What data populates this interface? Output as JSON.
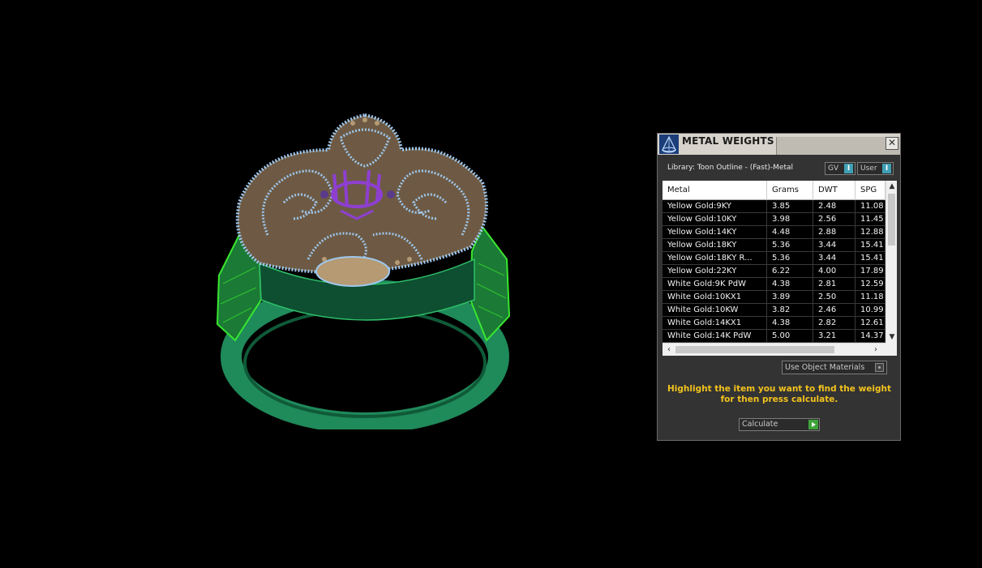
{
  "panel": {
    "title": "METAL WEIGHTS",
    "close_label": "✕",
    "library": "Library: Toon Outline - (Fast)-Metal",
    "toggles": [
      {
        "label": "GV",
        "indicator": "I"
      },
      {
        "label": "User",
        "indicator": "I"
      }
    ],
    "table": {
      "headers": [
        "Metal",
        "Grams",
        "DWT",
        "SPG"
      ],
      "rows": [
        [
          "Yellow Gold:9KY",
          "3.85",
          "2.48",
          "11.08"
        ],
        [
          "Yellow Gold:10KY",
          "3.98",
          "2.56",
          "11.45"
        ],
        [
          "Yellow Gold:14KY",
          "4.48",
          "2.88",
          "12.88"
        ],
        [
          "Yellow Gold:18KY",
          "5.36",
          "3.44",
          "15.41"
        ],
        [
          "Yellow Gold:18KY R...",
          "5.36",
          "3.44",
          "15.41"
        ],
        [
          "Yellow Gold:22KY",
          "6.22",
          "4.00",
          "17.89"
        ],
        [
          "White Gold:9K PdW",
          "4.38",
          "2.81",
          "12.59"
        ],
        [
          "White Gold:10KX1",
          "3.89",
          "2.50",
          "11.18"
        ],
        [
          "White Gold:10KW",
          "3.82",
          "2.46",
          "10.99"
        ],
        [
          "White Gold:14KX1",
          "4.38",
          "2.82",
          "12.61"
        ],
        [
          "White Gold:14K PdW",
          "5.00",
          "3.21",
          "14.37"
        ]
      ]
    },
    "use_object_materials": "Use Object Materials",
    "instructions": "Highlight the item you want to find the weight for then press calculate.",
    "calculate_label": "Calculate"
  },
  "colors": {
    "panel_bg": "#333333",
    "titlebar": "#d7d3cc",
    "instruction_text": "#f2c21d",
    "toggle_indicator": "#3fa0b4",
    "calc_go": "#3fa33a",
    "ring_band": "#1f8a5a",
    "ring_highlight": "#39e62f",
    "filigree": "#9ec8ee",
    "gold_metal": "#b59a74",
    "center_setting": "#8e3fd1"
  },
  "icons": {
    "app": "wireframe-cone-icon",
    "close": "close-icon",
    "scroll_up": "arrow-up-icon",
    "scroll_down": "arrow-down-icon",
    "scroll_left": "arrow-left-icon",
    "scroll_right": "arrow-right-icon",
    "calculate_go": "play-arrow-icon"
  }
}
